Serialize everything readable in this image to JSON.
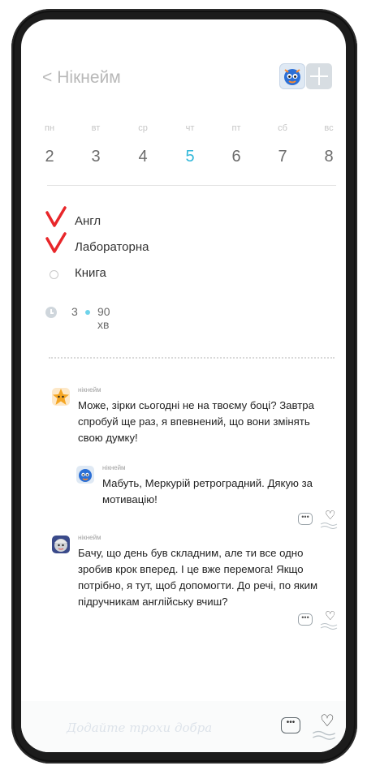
{
  "header": {
    "back_label": "Нікнейм"
  },
  "week": {
    "days": [
      {
        "name": "пн",
        "date": "2",
        "active": false
      },
      {
        "name": "вт",
        "date": "3",
        "active": false
      },
      {
        "name": "ср",
        "date": "4",
        "active": false
      },
      {
        "name": "чт",
        "date": "5",
        "active": true
      },
      {
        "name": "пт",
        "date": "6",
        "active": false
      },
      {
        "name": "сб",
        "date": "7",
        "active": false
      },
      {
        "name": "вс",
        "date": "8",
        "active": false
      }
    ]
  },
  "tasks": [
    {
      "label": "Англ",
      "done": true
    },
    {
      "label": "Лабораторна",
      "done": true
    },
    {
      "label": "Книга",
      "done": false
    }
  ],
  "timer": {
    "count": "3",
    "minutes": "90 хв"
  },
  "comments": [
    {
      "name": "нікнейм",
      "text": "Може, зірки сьогодні не на твоєму боці? Завтра спробуй ще раз, я впевнений, що вони змінять свою думку!"
    },
    {
      "name": "нікнейм",
      "text": "Мабуть, Меркурій ретроградний. Дякую за мотивацію!"
    },
    {
      "name": "нікнейм",
      "text": "Бачу, що день був складним, але ти все одно зробив крок вперед. І це вже перемога! Якщо потрібно, я тут, щоб допомогти. До речі, по яким підручникам англійську вчиш?"
    }
  ],
  "icons": {
    "bubble": "•••",
    "heart": "♡"
  },
  "composer": {
    "placeholder": "Додайте трохи добра"
  },
  "colors": {
    "accent": "#33b8da",
    "check": "#e8262a"
  }
}
